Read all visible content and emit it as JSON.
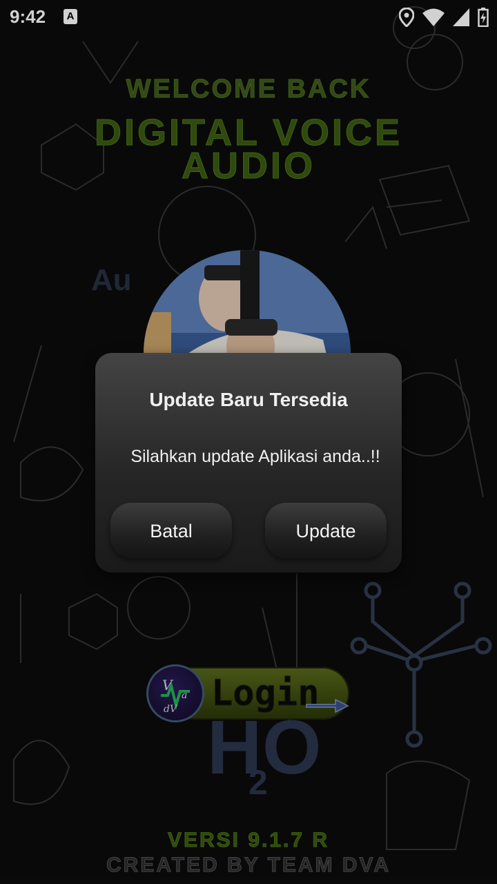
{
  "status_bar": {
    "time": "9:42",
    "notification_icon": "a-badge-icon",
    "icons": [
      "location-icon",
      "wifi-icon",
      "signal-icon",
      "battery-charging-icon"
    ]
  },
  "header": {
    "welcome": "WELCOME BACK",
    "app_name_line1": "DIGITAL VOICE",
    "app_name_line2": "AUDIO"
  },
  "login": {
    "label": "Login"
  },
  "footer": {
    "version": "VERSI 9.1.7  R",
    "credit": "CREATED BY TEAM DVA"
  },
  "dialog": {
    "title": "Update Baru Tersedia",
    "message": "Silahkan update Aplikasi anda..!!",
    "cancel_label": "Batal",
    "update_label": "Update"
  },
  "colors": {
    "title_green": "#3b5a12",
    "dialog_bg": "#2a2a2a"
  }
}
